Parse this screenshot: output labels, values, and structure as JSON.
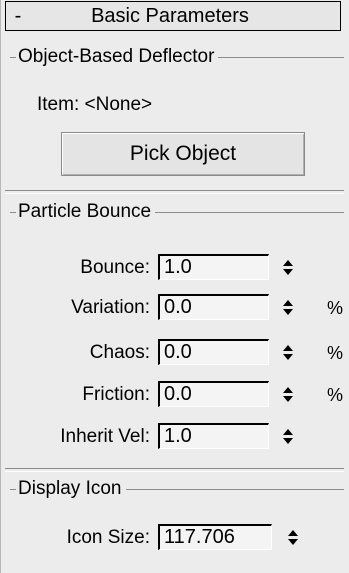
{
  "rollout": {
    "toggle": "-",
    "title": "Basic Parameters"
  },
  "deflector": {
    "group_title": "Object-Based Deflector",
    "item_label": "Item: <None>",
    "pick_button": "Pick Object"
  },
  "bounce": {
    "group_title": "Particle Bounce",
    "rows": [
      {
        "label": "Bounce:",
        "value": "1.0",
        "unit": ""
      },
      {
        "label": "Variation:",
        "value": "0.0",
        "unit": "%"
      },
      {
        "label": "Chaos:",
        "value": "0.0",
        "unit": "%"
      },
      {
        "label": "Friction:",
        "value": "0.0",
        "unit": "%"
      },
      {
        "label": "Inherit Vel:",
        "value": "1.0",
        "unit": ""
      }
    ]
  },
  "display": {
    "group_title": "Display Icon",
    "icon_size_label": "Icon Size:",
    "icon_size_value": "117.706"
  }
}
